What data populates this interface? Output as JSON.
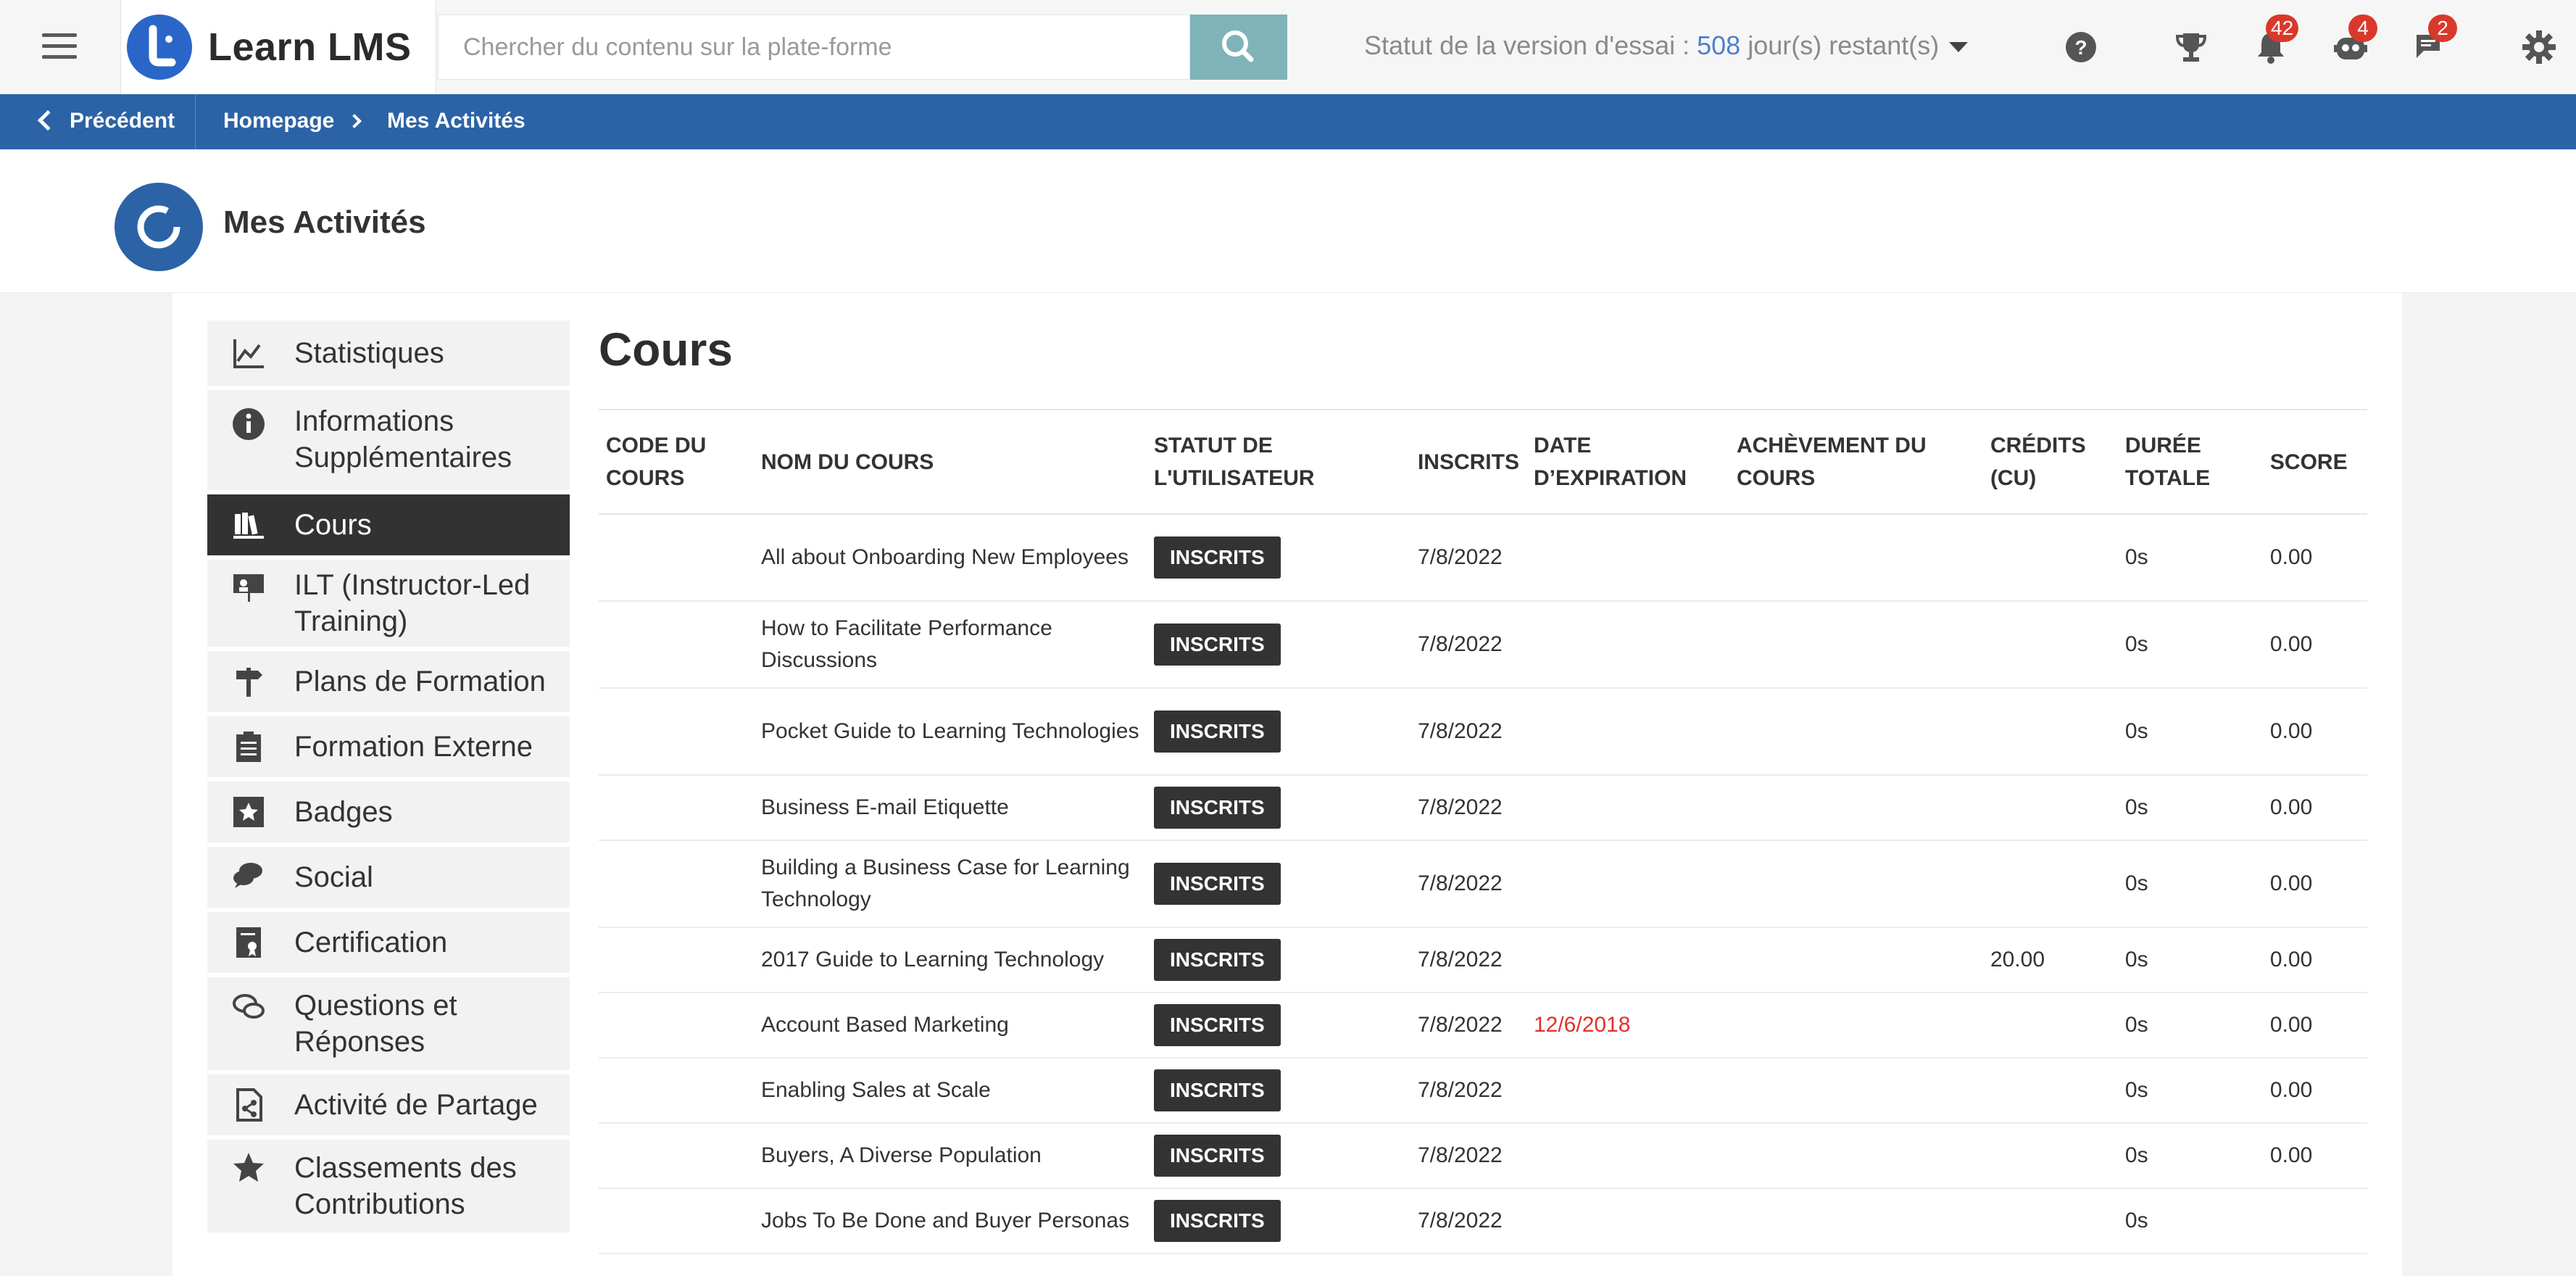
{
  "header": {
    "app_name": "Learn LMS",
    "search_placeholder": "Chercher du contenu sur la plate-forme",
    "trial_prefix": "Statut de la version d'essai : ",
    "trial_days": "508",
    "trial_suffix": " jour(s) restant(s)",
    "badges": {
      "notifications": "42",
      "bot": "4",
      "messages": "2"
    },
    "icons": [
      "menu-icon",
      "search-icon",
      "help-icon",
      "trophy-icon",
      "bell-icon",
      "bot-icon",
      "chat-icon",
      "gear-icon"
    ]
  },
  "breadcrumb": {
    "back_label": "Précédent",
    "home": "Homepage",
    "current": "Mes Activités"
  },
  "page": {
    "title": "Mes Activités"
  },
  "sidebar": {
    "items": [
      {
        "label": "Statistiques",
        "icon": "chart-line-icon"
      },
      {
        "label": "Informations Supplémentaires",
        "icon": "info-icon"
      },
      {
        "label": "Cours",
        "icon": "books-icon",
        "active": true
      },
      {
        "label": "ILT (Instructor-Led Training)",
        "icon": "presentation-icon"
      },
      {
        "label": "Plans de Formation",
        "icon": "signpost-icon"
      },
      {
        "label": "Formation Externe",
        "icon": "clipboard-icon"
      },
      {
        "label": "Badges",
        "icon": "star-badge-icon"
      },
      {
        "label": "Social",
        "icon": "speech-bubbles-icon"
      },
      {
        "label": "Certification",
        "icon": "certificate-icon"
      },
      {
        "label": "Questions et Réponses",
        "icon": "qa-bubbles-icon"
      },
      {
        "label": "Activité de Partage",
        "icon": "share-file-icon"
      },
      {
        "label": "Classements des Contributions",
        "icon": "star-icon"
      }
    ]
  },
  "main": {
    "heading": "Cours",
    "columns": [
      "CODE DU COURS",
      "NOM DU COURS",
      "STATUT DE L'UTILISATEUR",
      "INSCRITS",
      "DATE D’EXPIRATION",
      "ACHÈVEMENT DU COURS",
      "CRÉDITS (CU)",
      "DURÉE TOTALE",
      "SCORE"
    ],
    "rows": [
      {
        "code": "",
        "name": "All about Onboarding New Employees",
        "status": "INSCRITS",
        "enrolled": "7/8/2022",
        "expiry": "",
        "completion": "",
        "credits": "",
        "duration": "0s",
        "score": "0.00"
      },
      {
        "code": "",
        "name": "How to Facilitate Performance Discussions",
        "status": "INSCRITS",
        "enrolled": "7/8/2022",
        "expiry": "",
        "completion": "",
        "credits": "",
        "duration": "0s",
        "score": "0.00"
      },
      {
        "code": "",
        "name": "Pocket Guide to Learning Technologies",
        "status": "INSCRITS",
        "enrolled": "7/8/2022",
        "expiry": "",
        "completion": "",
        "credits": "",
        "duration": "0s",
        "score": "0.00"
      },
      {
        "code": "",
        "name": "Business E-mail Etiquette",
        "status": "INSCRITS",
        "enrolled": "7/8/2022",
        "expiry": "",
        "completion": "",
        "credits": "",
        "duration": "0s",
        "score": "0.00"
      },
      {
        "code": "",
        "name": "Building a Business Case for Learning Technology",
        "status": "INSCRITS",
        "enrolled": "7/8/2022",
        "expiry": "",
        "completion": "",
        "credits": "",
        "duration": "0s",
        "score": "0.00"
      },
      {
        "code": "",
        "name": "2017 Guide to Learning Technology",
        "status": "INSCRITS",
        "enrolled": "7/8/2022",
        "expiry": "",
        "completion": "",
        "credits": "20.00",
        "duration": "0s",
        "score": "0.00"
      },
      {
        "code": "",
        "name": "Account Based Marketing",
        "status": "INSCRITS",
        "enrolled": "7/8/2022",
        "expiry": "12/6/2018",
        "completion": "",
        "credits": "",
        "duration": "0s",
        "score": "0.00"
      },
      {
        "code": "",
        "name": "Enabling Sales at Scale",
        "status": "INSCRITS",
        "enrolled": "7/8/2022",
        "expiry": "",
        "completion": "",
        "credits": "",
        "duration": "0s",
        "score": "0.00"
      },
      {
        "code": "",
        "name": "Buyers, A Diverse Population",
        "status": "INSCRITS",
        "enrolled": "7/8/2022",
        "expiry": "",
        "completion": "",
        "credits": "",
        "duration": "0s",
        "score": "0.00"
      },
      {
        "code": "",
        "name": "Jobs To Be Done and Buyer Personas",
        "status": "INSCRITS",
        "enrolled": "7/8/2022",
        "expiry": "",
        "completion": "",
        "credits": "",
        "duration": "0s",
        "score": ""
      }
    ]
  },
  "colors": {
    "brand_blue": "#2b63a6",
    "logo_blue": "#2a66c8",
    "search_button": "#7eb3b8",
    "badge_red": "#d9392b",
    "expired_red": "#e2302a",
    "active_item": "#323232"
  }
}
